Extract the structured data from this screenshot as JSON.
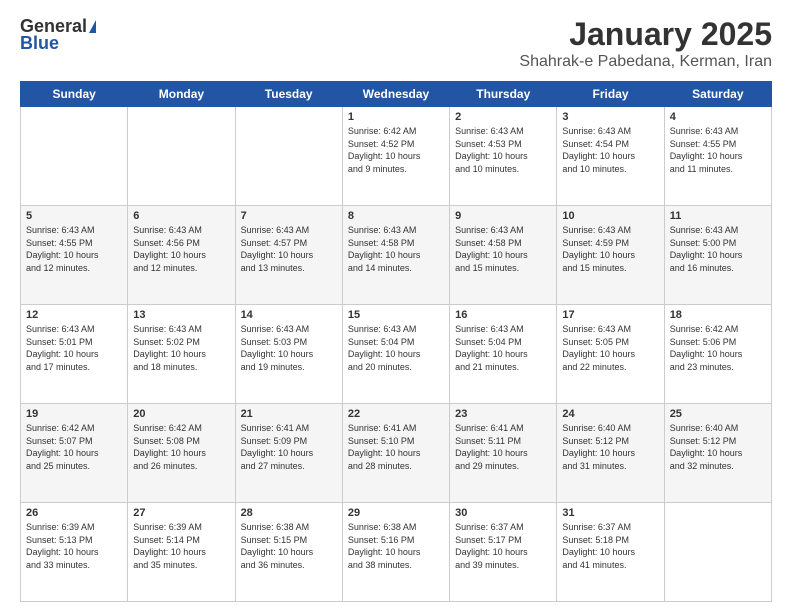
{
  "logo": {
    "general": "General",
    "blue": "Blue"
  },
  "title": "January 2025",
  "location": "Shahrak-e Pabedana, Kerman, Iran",
  "days_header": [
    "Sunday",
    "Monday",
    "Tuesday",
    "Wednesday",
    "Thursday",
    "Friday",
    "Saturday"
  ],
  "weeks": [
    [
      {
        "day": "",
        "info": ""
      },
      {
        "day": "",
        "info": ""
      },
      {
        "day": "",
        "info": ""
      },
      {
        "day": "1",
        "info": "Sunrise: 6:42 AM\nSunset: 4:52 PM\nDaylight: 10 hours\nand 9 minutes."
      },
      {
        "day": "2",
        "info": "Sunrise: 6:43 AM\nSunset: 4:53 PM\nDaylight: 10 hours\nand 10 minutes."
      },
      {
        "day": "3",
        "info": "Sunrise: 6:43 AM\nSunset: 4:54 PM\nDaylight: 10 hours\nand 10 minutes."
      },
      {
        "day": "4",
        "info": "Sunrise: 6:43 AM\nSunset: 4:55 PM\nDaylight: 10 hours\nand 11 minutes."
      }
    ],
    [
      {
        "day": "5",
        "info": "Sunrise: 6:43 AM\nSunset: 4:55 PM\nDaylight: 10 hours\nand 12 minutes."
      },
      {
        "day": "6",
        "info": "Sunrise: 6:43 AM\nSunset: 4:56 PM\nDaylight: 10 hours\nand 12 minutes."
      },
      {
        "day": "7",
        "info": "Sunrise: 6:43 AM\nSunset: 4:57 PM\nDaylight: 10 hours\nand 13 minutes."
      },
      {
        "day": "8",
        "info": "Sunrise: 6:43 AM\nSunset: 4:58 PM\nDaylight: 10 hours\nand 14 minutes."
      },
      {
        "day": "9",
        "info": "Sunrise: 6:43 AM\nSunset: 4:58 PM\nDaylight: 10 hours\nand 15 minutes."
      },
      {
        "day": "10",
        "info": "Sunrise: 6:43 AM\nSunset: 4:59 PM\nDaylight: 10 hours\nand 15 minutes."
      },
      {
        "day": "11",
        "info": "Sunrise: 6:43 AM\nSunset: 5:00 PM\nDaylight: 10 hours\nand 16 minutes."
      }
    ],
    [
      {
        "day": "12",
        "info": "Sunrise: 6:43 AM\nSunset: 5:01 PM\nDaylight: 10 hours\nand 17 minutes."
      },
      {
        "day": "13",
        "info": "Sunrise: 6:43 AM\nSunset: 5:02 PM\nDaylight: 10 hours\nand 18 minutes."
      },
      {
        "day": "14",
        "info": "Sunrise: 6:43 AM\nSunset: 5:03 PM\nDaylight: 10 hours\nand 19 minutes."
      },
      {
        "day": "15",
        "info": "Sunrise: 6:43 AM\nSunset: 5:04 PM\nDaylight: 10 hours\nand 20 minutes."
      },
      {
        "day": "16",
        "info": "Sunrise: 6:43 AM\nSunset: 5:04 PM\nDaylight: 10 hours\nand 21 minutes."
      },
      {
        "day": "17",
        "info": "Sunrise: 6:43 AM\nSunset: 5:05 PM\nDaylight: 10 hours\nand 22 minutes."
      },
      {
        "day": "18",
        "info": "Sunrise: 6:42 AM\nSunset: 5:06 PM\nDaylight: 10 hours\nand 23 minutes."
      }
    ],
    [
      {
        "day": "19",
        "info": "Sunrise: 6:42 AM\nSunset: 5:07 PM\nDaylight: 10 hours\nand 25 minutes."
      },
      {
        "day": "20",
        "info": "Sunrise: 6:42 AM\nSunset: 5:08 PM\nDaylight: 10 hours\nand 26 minutes."
      },
      {
        "day": "21",
        "info": "Sunrise: 6:41 AM\nSunset: 5:09 PM\nDaylight: 10 hours\nand 27 minutes."
      },
      {
        "day": "22",
        "info": "Sunrise: 6:41 AM\nSunset: 5:10 PM\nDaylight: 10 hours\nand 28 minutes."
      },
      {
        "day": "23",
        "info": "Sunrise: 6:41 AM\nSunset: 5:11 PM\nDaylight: 10 hours\nand 29 minutes."
      },
      {
        "day": "24",
        "info": "Sunrise: 6:40 AM\nSunset: 5:12 PM\nDaylight: 10 hours\nand 31 minutes."
      },
      {
        "day": "25",
        "info": "Sunrise: 6:40 AM\nSunset: 5:12 PM\nDaylight: 10 hours\nand 32 minutes."
      }
    ],
    [
      {
        "day": "26",
        "info": "Sunrise: 6:39 AM\nSunset: 5:13 PM\nDaylight: 10 hours\nand 33 minutes."
      },
      {
        "day": "27",
        "info": "Sunrise: 6:39 AM\nSunset: 5:14 PM\nDaylight: 10 hours\nand 35 minutes."
      },
      {
        "day": "28",
        "info": "Sunrise: 6:38 AM\nSunset: 5:15 PM\nDaylight: 10 hours\nand 36 minutes."
      },
      {
        "day": "29",
        "info": "Sunrise: 6:38 AM\nSunset: 5:16 PM\nDaylight: 10 hours\nand 38 minutes."
      },
      {
        "day": "30",
        "info": "Sunrise: 6:37 AM\nSunset: 5:17 PM\nDaylight: 10 hours\nand 39 minutes."
      },
      {
        "day": "31",
        "info": "Sunrise: 6:37 AM\nSunset: 5:18 PM\nDaylight: 10 hours\nand 41 minutes."
      },
      {
        "day": "",
        "info": ""
      }
    ]
  ]
}
